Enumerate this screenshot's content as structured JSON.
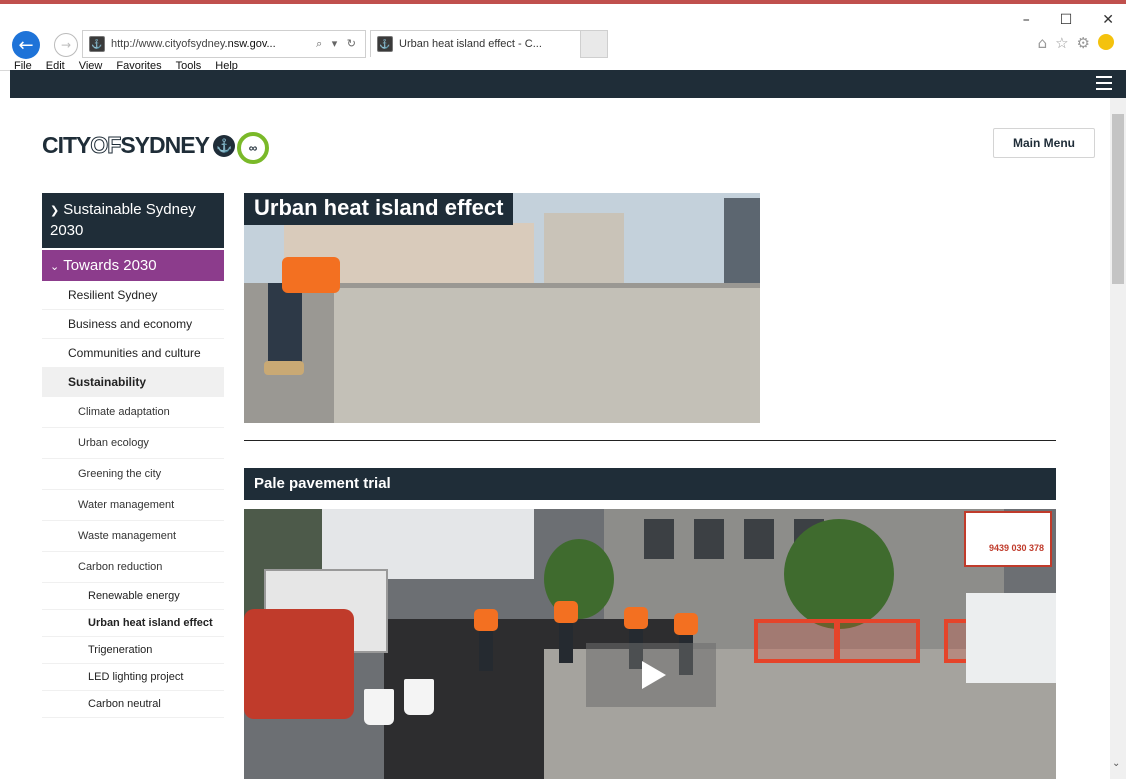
{
  "browser": {
    "address_prefix": "http://www.cityofsydney",
    "address_domain": ".nsw.gov...",
    "address_icons": "⌕ ▾ ↻",
    "tab_title": "Urban heat island effect - C...",
    "tab_close": "×",
    "window_controls": [
      "–",
      "☐",
      "✕"
    ],
    "menu": [
      "File",
      "Edit",
      "View",
      "Favorites",
      "Tools",
      "Help"
    ]
  },
  "site": {
    "logo_city": "CITY",
    "logo_of": "OF",
    "logo_sydney": "SYDNEY",
    "main_menu": "Main Menu"
  },
  "sidenav": {
    "top": "Sustainable Sydney 2030",
    "towards": "Towards 2030",
    "level2": [
      {
        "label": "Resilient Sydney"
      },
      {
        "label": "Business and economy"
      },
      {
        "label": "Communities and culture"
      },
      {
        "label": "Sustainability"
      }
    ],
    "level3": [
      {
        "label": "Climate adaptation"
      },
      {
        "label": "Urban ecology"
      },
      {
        "label": "Greening the city"
      },
      {
        "label": "Water management"
      },
      {
        "label": "Waste management"
      },
      {
        "label": "Carbon reduction"
      }
    ],
    "level4": [
      {
        "label": "Renewable energy"
      },
      {
        "label": "Urban heat island effect"
      },
      {
        "label": "Trigeneration"
      },
      {
        "label": "LED lighting project"
      },
      {
        "label": "Carbon neutral"
      }
    ]
  },
  "main": {
    "hero_title": "Urban heat island effect",
    "section_title": "Pale pavement trial",
    "video_sign_text": "9439 030 378"
  },
  "colors": {
    "navy": "#1f2d38",
    "purple": "#8c3c8c",
    "logo_green": "#7ab929"
  }
}
